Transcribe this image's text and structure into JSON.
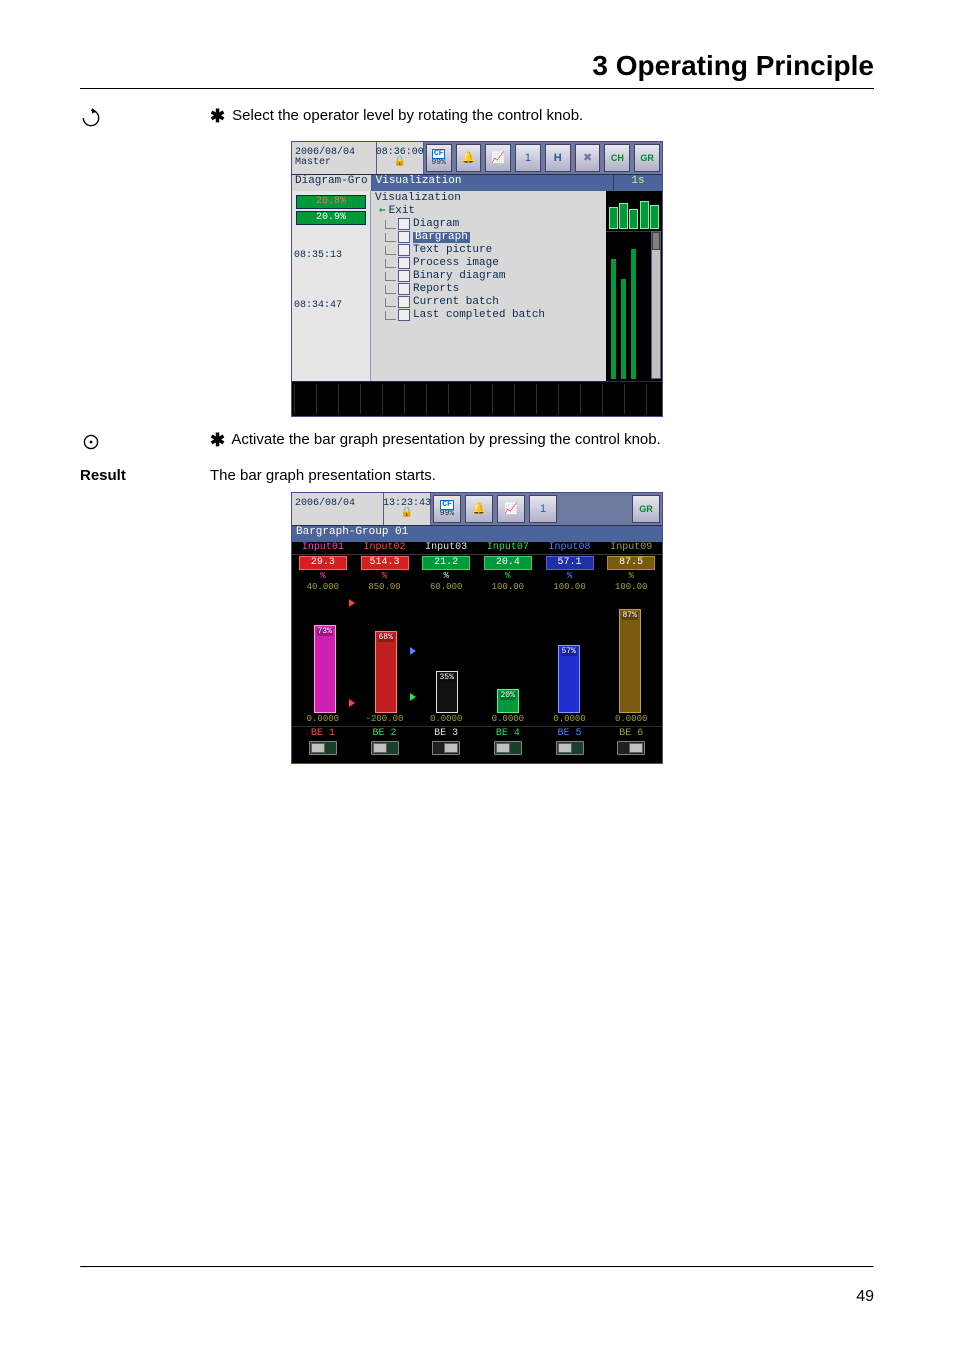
{
  "chapter_title": "3 Operating Principle",
  "step1_text": "Select the operator level by rotating the control knob.",
  "step2_text": "Activate the bar graph presentation by pressing the control knob.",
  "result_label": "Result",
  "result_text": "The bar graph presentation starts.",
  "bullet_char": "✱",
  "page_number": "49",
  "scr1": {
    "date": "2006/08/04",
    "user": "Master",
    "time": "08:36:00",
    "cf_label": "CF",
    "cf_pct": "99%",
    "h_icon": "H",
    "ch_icon": "CH",
    "gr_icon": "GR",
    "title_left": "Diagram-Gro",
    "title_menu": "Visualization",
    "time_span": "1s",
    "pct1": "20.8%",
    "pct2": "20.9%",
    "tick1": "08:35:13",
    "tick2": "08:34:47",
    "tree_head": "Visualization",
    "tree_exit": "Exit",
    "items": [
      "Diagram",
      "Bargraph",
      "Text picture",
      "Process image",
      "Binary diagram",
      "Reports",
      "Current batch",
      "Last completed batch"
    ],
    "selected_index": 1
  },
  "scr2": {
    "date": "2006/08/04",
    "time": "13:23:43",
    "cf_label": "CF",
    "cf_pct": "99%",
    "gr_icon": "GR",
    "title": "Bargraph-Group 01",
    "channels": [
      {
        "name": "Input01",
        "value": "29.3",
        "unit": "%",
        "top": "40.000",
        "bottom": "0.0000",
        "pct": "73%",
        "color": "mag",
        "name_color": "c-mag",
        "valclass": "vb-red"
      },
      {
        "name": "Input02",
        "value": "514.3",
        "unit": "%",
        "top": "850.00",
        "bottom": "-200.00",
        "pct": "68%",
        "color": "red",
        "name_color": "c-red",
        "valclass": "vb-red"
      },
      {
        "name": "Input03",
        "value": "21.2",
        "unit": "%",
        "top": "60.000",
        "bottom": "0.0000",
        "pct": "35%",
        "color": "wht",
        "name_color": "c-wht",
        "valclass": "vb-grn"
      },
      {
        "name": "Input07",
        "value": "20.4",
        "unit": "%",
        "top": "100.00",
        "bottom": "0.0000",
        "pct": "20%",
        "color": "grn",
        "name_color": "c-grn",
        "valclass": "vb-grn"
      },
      {
        "name": "Input08",
        "value": "57.1",
        "unit": "%",
        "top": "100.00",
        "bottom": "0.0000",
        "pct": "57%",
        "color": "blu",
        "name_color": "c-blu",
        "valclass": "vb-blu"
      },
      {
        "name": "Input09",
        "value": "87.5",
        "unit": "%",
        "top": "100.00",
        "bottom": "0.0000",
        "pct": "87%",
        "color": "brn",
        "name_color": "c-olv",
        "valclass": "vb-brn"
      }
    ],
    "be": [
      {
        "label": "BE 1",
        "color": "c-red",
        "state": "on"
      },
      {
        "label": "BE 2",
        "color": "c-grn",
        "state": "on"
      },
      {
        "label": "BE 3",
        "color": "c-wht",
        "state": "off"
      },
      {
        "label": "BE 4",
        "color": "c-grn",
        "state": "on"
      },
      {
        "label": "BE 5",
        "color": "c-blu",
        "state": "on"
      },
      {
        "label": "BE 6",
        "color": "c-olv",
        "state": "off"
      }
    ]
  },
  "chart_data": [
    {
      "type": "bar",
      "title": "Bargraph-Group 01",
      "series": [
        {
          "name": "Input01",
          "value_label": "29.3",
          "percent": 73,
          "scale_min": 0.0,
          "scale_max": 40.0
        },
        {
          "name": "Input02",
          "value_label": "514.3",
          "percent": 68,
          "scale_min": -200.0,
          "scale_max": 850.0
        },
        {
          "name": "Input03",
          "value_label": "21.2",
          "percent": 35,
          "scale_min": 0.0,
          "scale_max": 60.0
        },
        {
          "name": "Input07",
          "value_label": "20.4",
          "percent": 20,
          "scale_min": 0.0,
          "scale_max": 100.0
        },
        {
          "name": "Input08",
          "value_label": "57.1",
          "percent": 57,
          "scale_min": 0.0,
          "scale_max": 100.0
        },
        {
          "name": "Input09",
          "value_label": "87.5",
          "percent": 87,
          "scale_min": 0.0,
          "scale_max": 100.0
        }
      ],
      "ylabel": "%"
    }
  ]
}
